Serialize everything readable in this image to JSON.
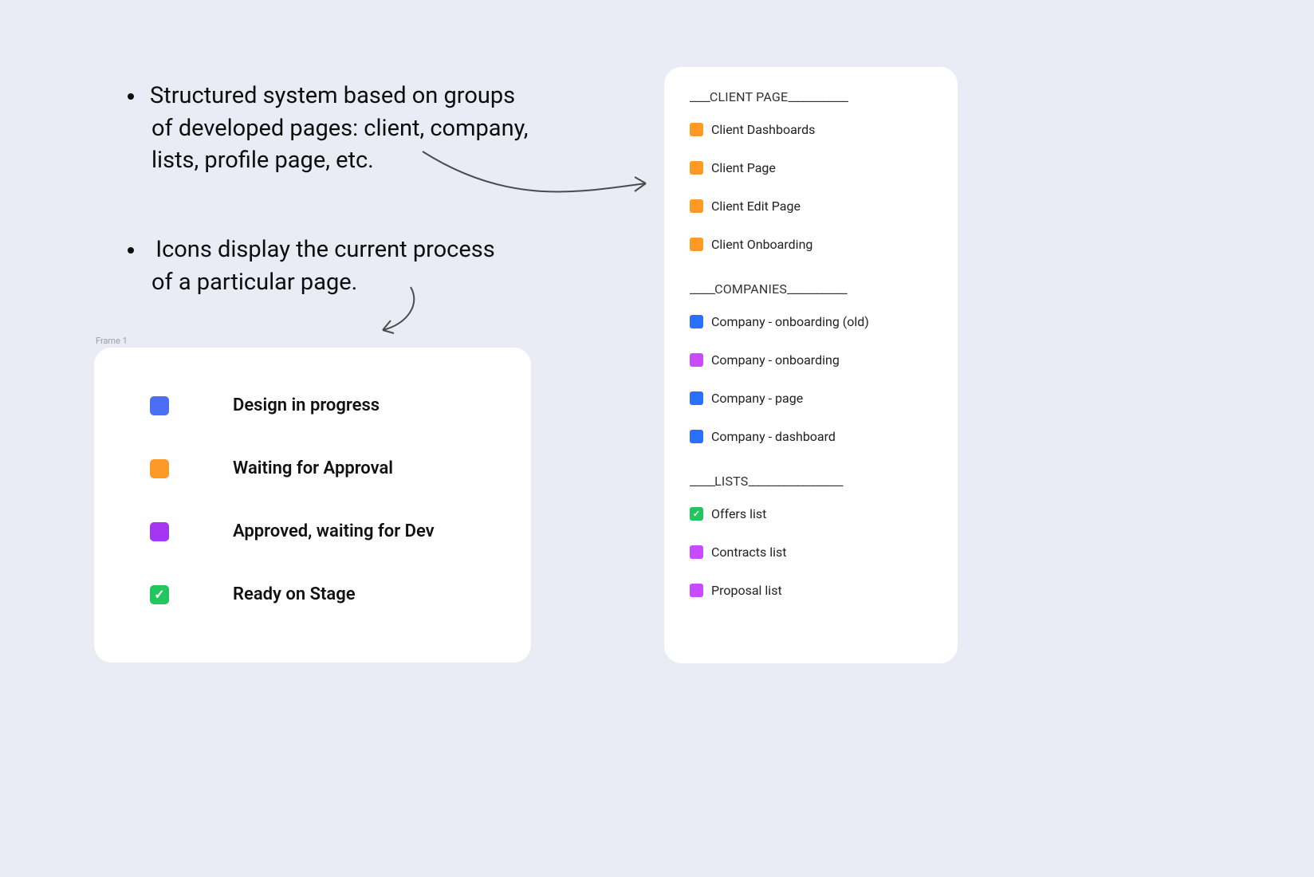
{
  "bullets": [
    {
      "lines": [
        "Structured system based on groups",
        "of developed pages: client, company,",
        "lists, profile page, etc."
      ]
    },
    {
      "lines": [
        " Icons display the current process",
        "of a particular page."
      ]
    }
  ],
  "frame_label": "Frame 1",
  "legend": [
    {
      "color": "blue",
      "label": "Design in progress"
    },
    {
      "color": "orange",
      "label": "Waiting for Approval"
    },
    {
      "color": "purple",
      "label": "Approved, waiting for Dev"
    },
    {
      "color": "green",
      "label": "Ready on Stage",
      "check": true
    }
  ],
  "sidebar": {
    "sections": [
      {
        "header": {
          "pre": "____",
          "title": "CLIENT PAGE",
          "post": "____________"
        },
        "items": [
          {
            "color": "orange",
            "label": "Client Dashboards"
          },
          {
            "color": "orange",
            "label": "Client Page"
          },
          {
            "color": "orange",
            "label": "Client Edit Page"
          },
          {
            "color": "orange",
            "label": "Client Onboarding"
          }
        ]
      },
      {
        "header": {
          "pre": "_____",
          "title": "COMPANIES",
          "post": "____________"
        },
        "items": [
          {
            "color": "blue",
            "label": "Company - onboarding (old)"
          },
          {
            "color": "purple",
            "label": " Company - onboarding"
          },
          {
            "color": "blue",
            "label": " Company - page"
          },
          {
            "color": "blue",
            "label": "Company - dashboard"
          }
        ]
      },
      {
        "header": {
          "pre": "_____",
          "title": "LISTS",
          "post": "___________________"
        },
        "items": [
          {
            "color": "green",
            "label": "Offers list",
            "check": true
          },
          {
            "color": "purple",
            "label": "Contracts list"
          },
          {
            "color": "purple",
            "label": "Proposal list"
          }
        ]
      }
    ]
  }
}
